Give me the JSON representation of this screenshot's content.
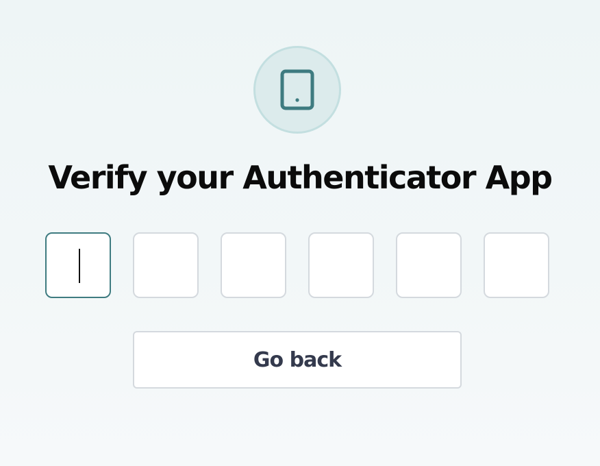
{
  "header": {
    "icon": "tablet-icon",
    "title": "Verify your Authenticator App"
  },
  "otp": {
    "length": 6,
    "digits": [
      "",
      "",
      "",
      "",
      "",
      ""
    ],
    "active_index": 0
  },
  "actions": {
    "back_label": "Go back"
  },
  "colors": {
    "accent": "#3e7b80",
    "icon_bg": "#dcebec",
    "icon_ring": "#c3dfe0",
    "title_text": "#0b0b0b",
    "button_text": "#343a4d",
    "border": "#d4d9de"
  }
}
